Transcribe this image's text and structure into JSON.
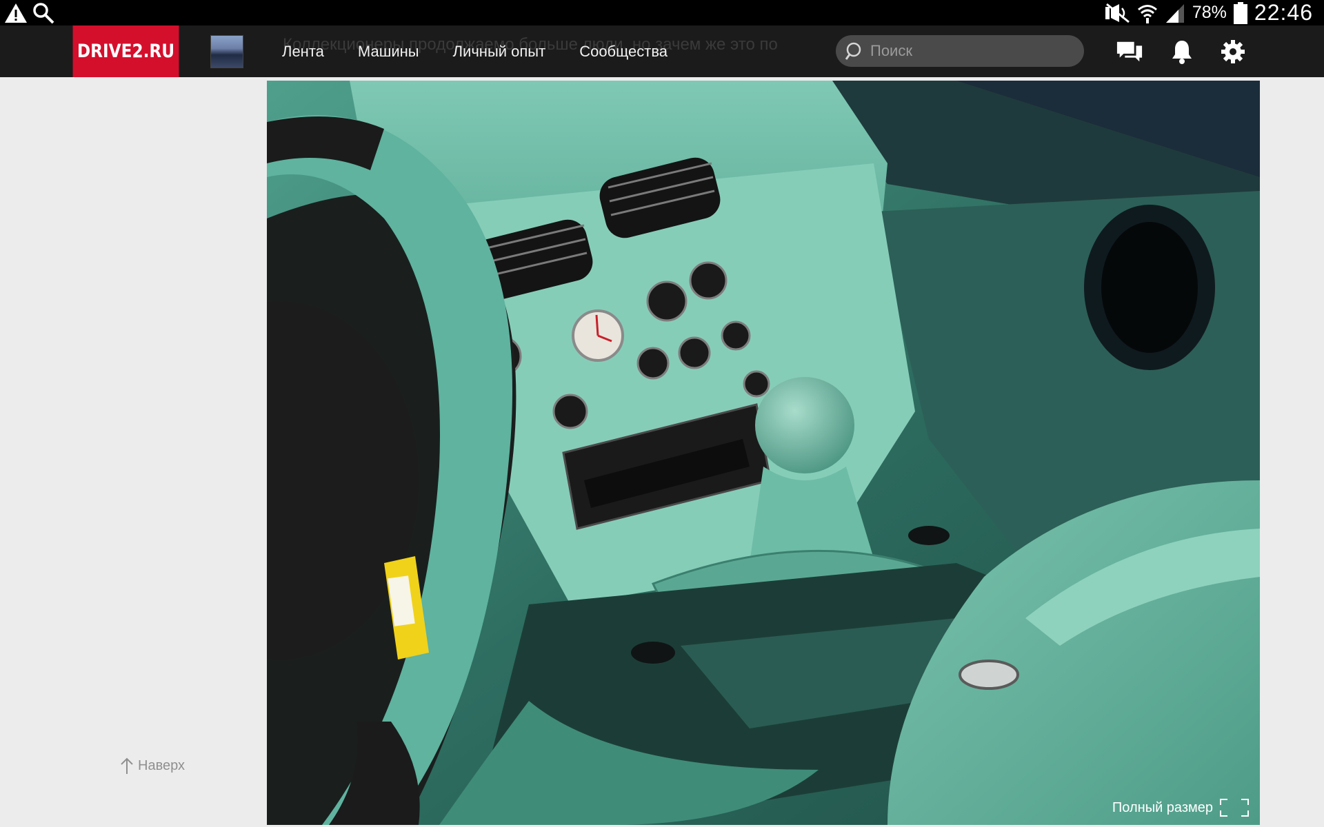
{
  "status_bar": {
    "battery_percent": "78%",
    "time": "22:46",
    "icons": [
      "warning-icon",
      "search-icon",
      "mute-icon",
      "wifi-icon",
      "signal-icon",
      "battery-icon"
    ]
  },
  "header": {
    "logo": "DRIVE2.RU",
    "ghost_text": "Коллекционеры продолжаемо больше люди, но зачем же это по",
    "nav": [
      "Лента",
      "Машины",
      "Личный опыт",
      "Сообщества"
    ],
    "search_placeholder": "Поиск",
    "icons": [
      "messages-icon",
      "bell-icon",
      "gear-icon"
    ]
  },
  "photo": {
    "alt": "Aston Martin interior, teal leather",
    "fullsize_label": "Полный размер"
  },
  "sidebar": {
    "back_to_top": "Наверх"
  },
  "colors": {
    "brand_red": "#d40f2c",
    "header_bg": "#1b1b1b",
    "page_bg": "#ececec",
    "leather_teal": "#5fb39f"
  }
}
